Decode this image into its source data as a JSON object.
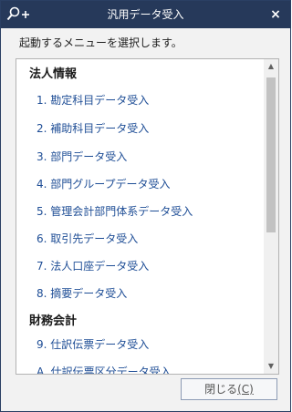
{
  "window": {
    "title": "汎用データ受入",
    "close_glyph": "×",
    "title_icon": "search-plus-icon"
  },
  "instruction": "起動するメニューを選択します。",
  "sections": [
    {
      "title": "法人情報",
      "items": [
        {
          "label": "1. 勘定科目データ受入"
        },
        {
          "label": "2. 補助科目データ受入"
        },
        {
          "label": "3. 部門データ受入"
        },
        {
          "label": "4. 部門グループデータ受入"
        },
        {
          "label": "5. 管理会計部門体系データ受入"
        },
        {
          "label": "6. 取引先データ受入"
        },
        {
          "label": "7. 法人口座データ受入"
        },
        {
          "label": "8. 摘要データ受入"
        }
      ]
    },
    {
      "title": "財務会計",
      "items": [
        {
          "label": "9. 仕訳伝票データ受入"
        },
        {
          "label": "A. 仕訳伝票区分データ受入"
        }
      ]
    }
  ],
  "scrollbar": {
    "up_glyph": "▲",
    "down_glyph": "▼",
    "scroll_fraction": 0
  },
  "footer": {
    "close_label": "閉じる",
    "close_accel": "(C)"
  },
  "colors": {
    "titlebar": "#26395a",
    "link": "#1f4e96",
    "window_bg": "#f2f2f2"
  }
}
